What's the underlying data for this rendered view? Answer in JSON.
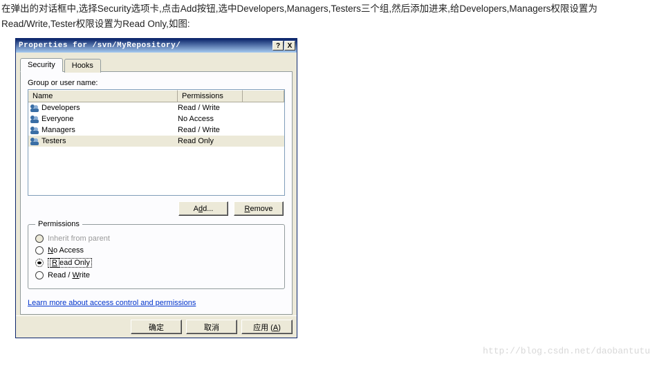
{
  "intro": {
    "line1": "在弹出的对话框中,选择Security选项卡,点击Add按钮,选中Developers,Managers,Testers三个组,然后添加进来,给Developers,Managers权限设置为Read/Write,Tester权限设置为Read Only,如图:"
  },
  "dialog": {
    "title": "Properties for /svn/MyRepository/",
    "help_btn": "?",
    "close_btn": "X",
    "tabs": [
      {
        "label": "Security",
        "active": true
      },
      {
        "label": "Hooks",
        "active": false
      }
    ],
    "group_label": "Group or user name:",
    "columns": {
      "name": "Name",
      "permissions": "Permissions"
    },
    "rows": [
      {
        "name": "Developers",
        "permission": "Read / Write",
        "selected": false
      },
      {
        "name": "Everyone",
        "permission": "No Access",
        "selected": false
      },
      {
        "name": "Managers",
        "permission": "Read / Write",
        "selected": false
      },
      {
        "name": "Testers",
        "permission": "Read Only",
        "selected": true
      }
    ],
    "add_btn": "Add...",
    "remove_btn": "Remove",
    "permissions_box": {
      "legend": "Permissions",
      "options": [
        {
          "label": "Inherit from parent",
          "accel": "",
          "enabled": false,
          "selected": false
        },
        {
          "label": "No Access",
          "accel": "N",
          "enabled": true,
          "selected": false
        },
        {
          "label": "Read Only",
          "accel": "R",
          "enabled": true,
          "selected": true
        },
        {
          "label": "Read / Write",
          "accel": "W",
          "enabled": true,
          "selected": false
        }
      ]
    },
    "learn_more": "Learn more about access control and permissions",
    "ok_btn": "确定",
    "cancel_btn": "取消",
    "apply_btn": "应用 (A)"
  },
  "watermark": "http://blog.csdn.net/daobantutu"
}
